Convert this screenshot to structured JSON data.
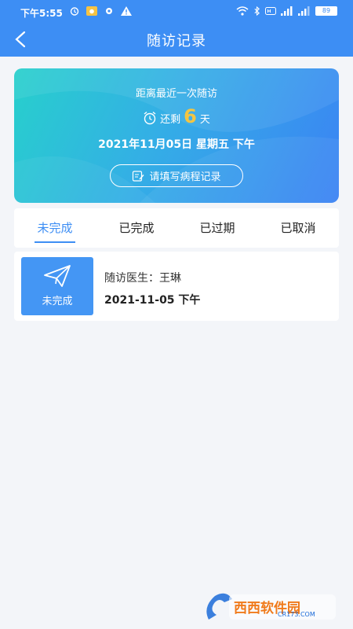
{
  "status_bar": {
    "time": "下午5:55",
    "battery": "89"
  },
  "nav": {
    "title": "随访记录"
  },
  "banner": {
    "title": "距离最近一次随访",
    "remaining_prefix": "还剩",
    "remaining_days": "6",
    "remaining_suffix": "天",
    "date": "2021年11月05日 星期五 下午",
    "record_button": "请填写病程记录"
  },
  "tabs": [
    {
      "label": "未完成",
      "active": true
    },
    {
      "label": "已完成",
      "active": false
    },
    {
      "label": "已过期",
      "active": false
    },
    {
      "label": "已取消",
      "active": false
    }
  ],
  "records": [
    {
      "status": "未完成",
      "doctor": "随访医生：王琳",
      "date": "2021-11-05 下午"
    }
  ],
  "watermark": {
    "text": "西西软件园",
    "sub": "CR173.COM"
  },
  "colors": {
    "primary": "#3d8ef4",
    "accent_number": "#f4c542",
    "background": "#f3f5f9"
  }
}
